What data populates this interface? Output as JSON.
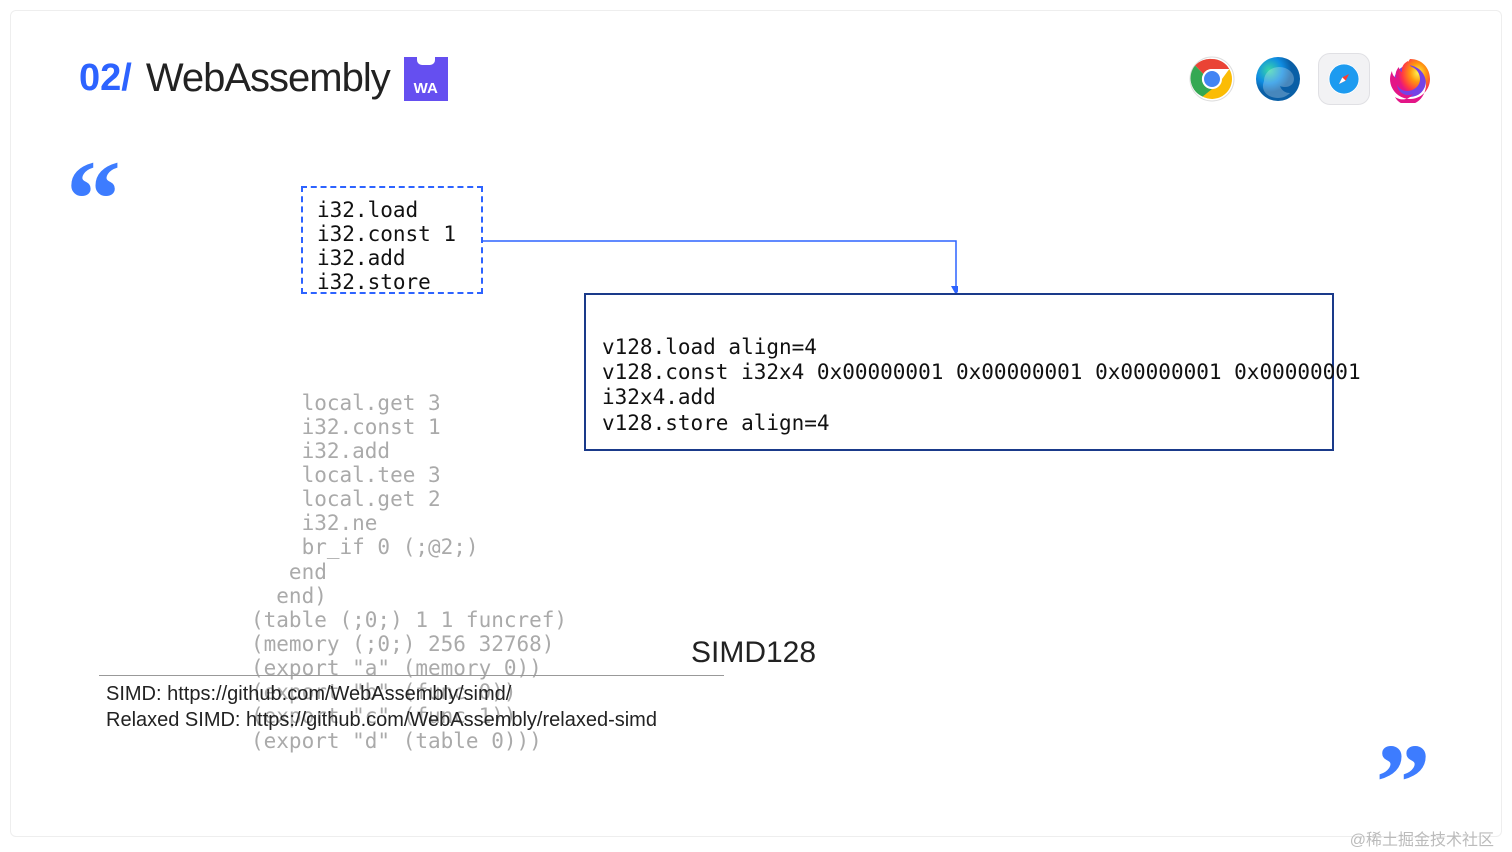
{
  "header": {
    "section_number": "02/",
    "title": "WebAssembly",
    "badge_label": "WA"
  },
  "browsers": [
    "chrome",
    "edge",
    "safari",
    "firefox"
  ],
  "highlight_code": "i32.load\ni32.const 1\ni32.add\ni32.store",
  "faded_code": "    local.get 3\n    i32.const 1\n    i32.add\n    local.tee 3\n    local.get 2\n    i32.ne\n    br_if 0 (;@2;)\n   end\n  end)\n(table (;0;) 1 1 funcref)\n(memory (;0;) 256 32768)\n(export \"a\" (memory 0))\n(export \"b\" (func 0))\n(export \"c\" (func 1))\n(export \"d\" (table 0)))",
  "simd_code": "v128.load align=4\nv128.const i32x4 0x00000001 0x00000001 0x00000001 0x00000001\ni32x4.add\nv128.store align=4",
  "caption": "SIMD128",
  "refs": {
    "line1": "SIMD: https://github.com/WebAssembly/simd/",
    "line2": "Relaxed SIMD: https://github.com/WebAssembly/relaxed-simd"
  },
  "watermark": "@稀土掘金技术社区"
}
